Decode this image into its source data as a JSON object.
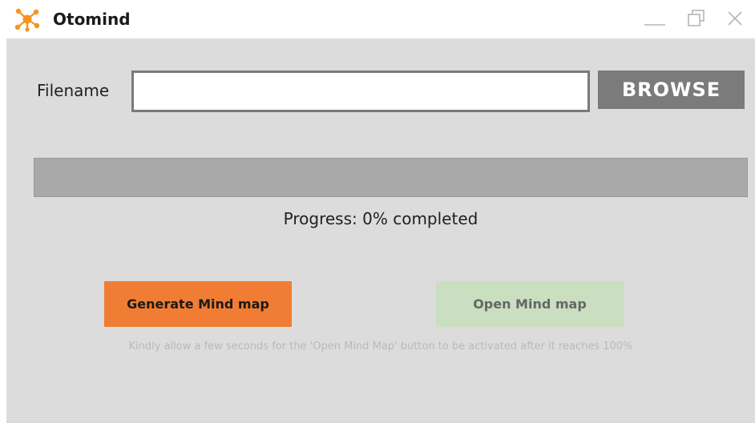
{
  "window": {
    "title": "Otomind",
    "controls": {
      "minimize_icon": "minimize-icon",
      "maximize_icon": "restore-icon",
      "close_icon": "close-icon"
    },
    "logo_icon": "otomind-logo-icon",
    "logo_color": "#f7941d"
  },
  "form": {
    "filename_label": "Filename",
    "filename_value": "",
    "filename_placeholder": "",
    "browse_label": "BROWSE"
  },
  "progress": {
    "percent": 0,
    "text": "Progress: 0% completed",
    "fill_color": "#f27c2a",
    "track_color": "#a9a9a9"
  },
  "actions": {
    "generate_label": "Generate Mind map",
    "generate_color": "#f07d33",
    "open_label": "Open Mind map",
    "open_color": "#c9dfc0",
    "open_enabled": false
  },
  "hint": "Kindly allow a few seconds for the 'Open Mind Map' button to be activated after it reaches 100%"
}
